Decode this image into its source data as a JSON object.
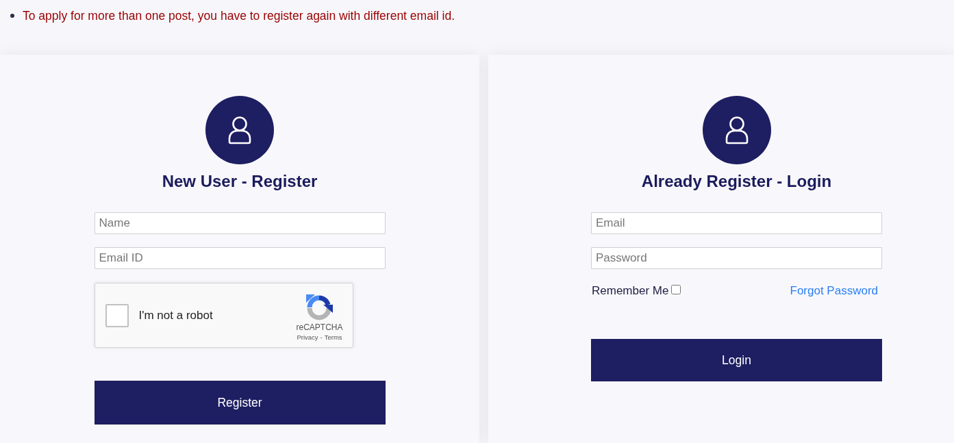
{
  "notices": [
    {
      "text": "To apply for more than one post, you have to register again with different email id."
    }
  ],
  "register_panel": {
    "title": "New User - Register",
    "fields": [
      {
        "placeholder": "Name"
      },
      {
        "placeholder": "Email ID"
      }
    ],
    "captcha": {
      "label": "I'm not a robot",
      "checked": false,
      "brand": "reCAPTCHA",
      "privacy": "Privacy",
      "separator": "-",
      "terms": "Terms"
    },
    "button": "Register"
  },
  "login_panel": {
    "title": "Already Register - Login",
    "fields": [
      {
        "placeholder": "Email"
      },
      {
        "placeholder": "Password"
      }
    ],
    "remember": {
      "label": "Remember Me",
      "checked": false
    },
    "forgot_link": "Forgot Password",
    "button": "Login"
  }
}
